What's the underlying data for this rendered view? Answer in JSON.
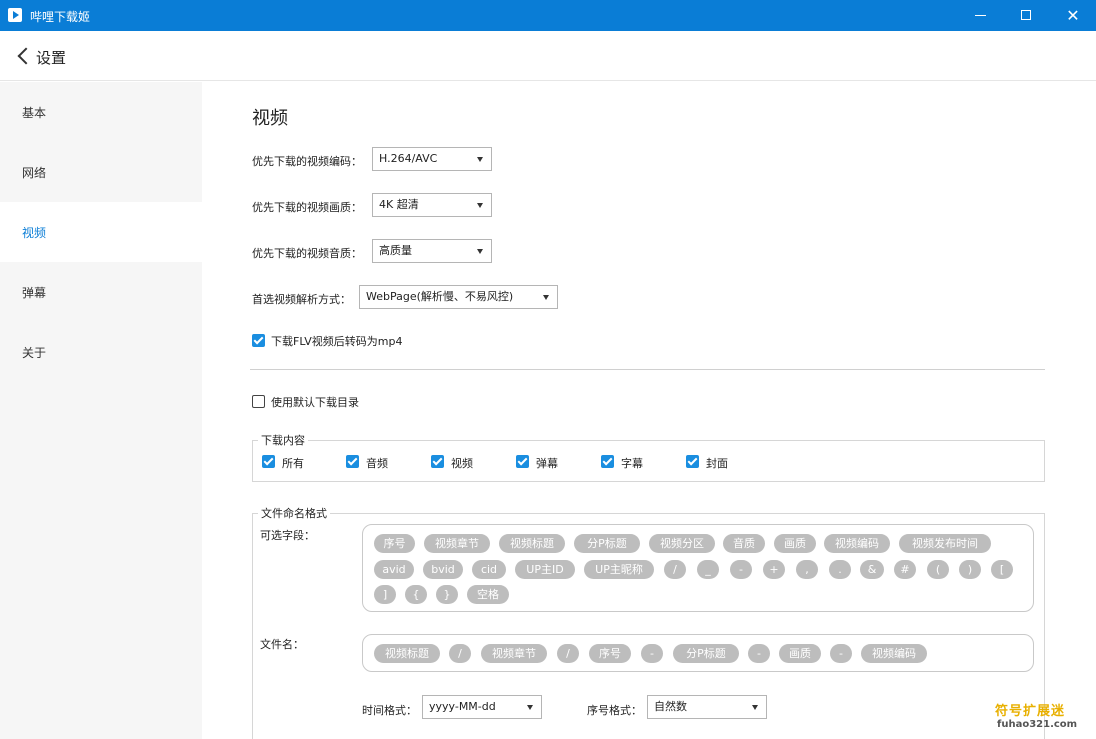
{
  "window": {
    "title": "哔哩下载姬",
    "minimize": "",
    "maximize": "",
    "close": "✕"
  },
  "header": {
    "title": "设置"
  },
  "sidebar": {
    "items": [
      {
        "label": "基本"
      },
      {
        "label": "网络"
      },
      {
        "label": "视频"
      },
      {
        "label": "弹幕"
      },
      {
        "label": "关于"
      }
    ],
    "active": "视频"
  },
  "main": {
    "section_title": "视频",
    "codec": {
      "label": "优先下载的视频编码：",
      "value": "H.264/AVC"
    },
    "quality": {
      "label": "优先下载的视频画质：",
      "value": "4K 超清"
    },
    "audio": {
      "label": "优先下载的视频音质：",
      "value": "高质量"
    },
    "parse": {
      "label": "首选视频解析方式：",
      "value": "WebPage(解析慢、不易风控)"
    },
    "flv_to_mp4": {
      "label": "下载FLV视频后转码为mp4",
      "checked": true
    },
    "default_dir": {
      "label": "使用默认下载目录",
      "checked": false
    },
    "download_content": {
      "title": "下载内容",
      "items": [
        {
          "label": "所有",
          "checked": true
        },
        {
          "label": "音频",
          "checked": true
        },
        {
          "label": "视频",
          "checked": true
        },
        {
          "label": "弹幕",
          "checked": true
        },
        {
          "label": "字幕",
          "checked": true
        },
        {
          "label": "封面",
          "checked": true
        }
      ]
    },
    "naming": {
      "title": "文件命名格式",
      "optional_label": "可选字段：",
      "optional_fields": [
        "序号",
        "视频章节",
        "视频标题",
        "分P标题",
        "视频分区",
        "音质",
        "画质",
        "视频编码",
        "视频发布时间",
        "avid",
        "bvid",
        "cid",
        "UP主ID",
        "UP主昵称",
        "/",
        "_",
        "-",
        "+",
        ",",
        ".",
        "&",
        "#",
        "(",
        ")",
        "[",
        "]",
        "{",
        "}",
        "空格"
      ],
      "filename_label": "文件名：",
      "filename_fields": [
        "视频标题",
        "/",
        "视频章节",
        "/",
        "序号",
        "-",
        "分P标题",
        "-",
        "画质",
        "-",
        "视频编码"
      ],
      "time_format": {
        "label": "时间格式：",
        "value": "yyyy-MM-dd"
      },
      "index_format": {
        "label": "序号格式：",
        "value": "自然数"
      }
    }
  },
  "watermark": {
    "main": "符号扩展迷",
    "sub": "fuhao321.com"
  }
}
